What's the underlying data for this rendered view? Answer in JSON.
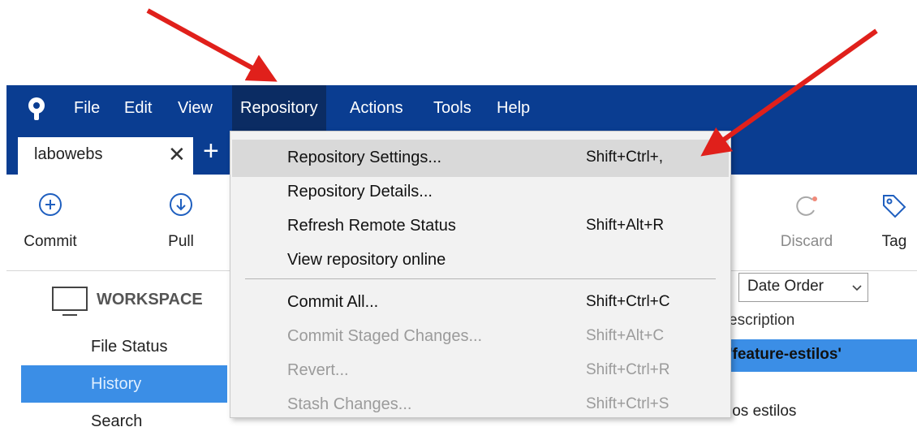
{
  "menubar": {
    "items": [
      "File",
      "Edit",
      "View",
      "Repository",
      "Actions",
      "Tools",
      "Help"
    ],
    "active": "Repository"
  },
  "tabs": {
    "repo_name": "labowebs",
    "close_glyph": "✕",
    "add_glyph": "+"
  },
  "toolbar": {
    "commit_label": "Commit",
    "pull_label": "Pull",
    "discard_label": "Discard",
    "tag_label": "Tag"
  },
  "sidebar": {
    "workspace_label": "WORKSPACE",
    "items": [
      {
        "label": "File Status",
        "selected": false
      },
      {
        "label": "History",
        "selected": true
      },
      {
        "label": "Search",
        "selected": false
      }
    ]
  },
  "history": {
    "sort_label": "Date Order",
    "description_header": "escription",
    "selected_row_text": "'feature-estilos'",
    "row_2_text": "los estilos"
  },
  "repository_menu": {
    "items": [
      {
        "label": "Repository Settings...",
        "shortcut": "Shift+Ctrl+,",
        "disabled": false,
        "highlighted": true
      },
      {
        "label": "Repository Details...",
        "shortcut": "",
        "disabled": false,
        "highlighted": false
      },
      {
        "label": "Refresh Remote Status",
        "shortcut": "Shift+Alt+R",
        "disabled": false,
        "highlighted": false
      },
      {
        "label": "View repository online",
        "shortcut": "",
        "disabled": false,
        "highlighted": false
      },
      {
        "label": "Commit All...",
        "shortcut": "Shift+Ctrl+C",
        "disabled": false,
        "highlighted": false
      },
      {
        "label": "Commit Staged Changes...",
        "shortcut": "Shift+Alt+C",
        "disabled": true,
        "highlighted": false
      },
      {
        "label": "Revert...",
        "shortcut": "Shift+Ctrl+R",
        "disabled": true,
        "highlighted": false
      },
      {
        "label": "Stash Changes...",
        "shortcut": "Shift+Ctrl+S",
        "disabled": true,
        "highlighted": false
      }
    ]
  },
  "colors": {
    "menubar": "#0a3d91",
    "active_menu": "#0b2c63",
    "selection": "#3b8ee6",
    "annotation_arrow": "#e0201b"
  },
  "icons": [
    "sourcetree-logo-icon",
    "plus-icon",
    "commit-icon",
    "pull-icon",
    "discard-icon",
    "tag-icon",
    "monitor-icon",
    "chevron-down-icon",
    "annotation-arrow-icon"
  ]
}
